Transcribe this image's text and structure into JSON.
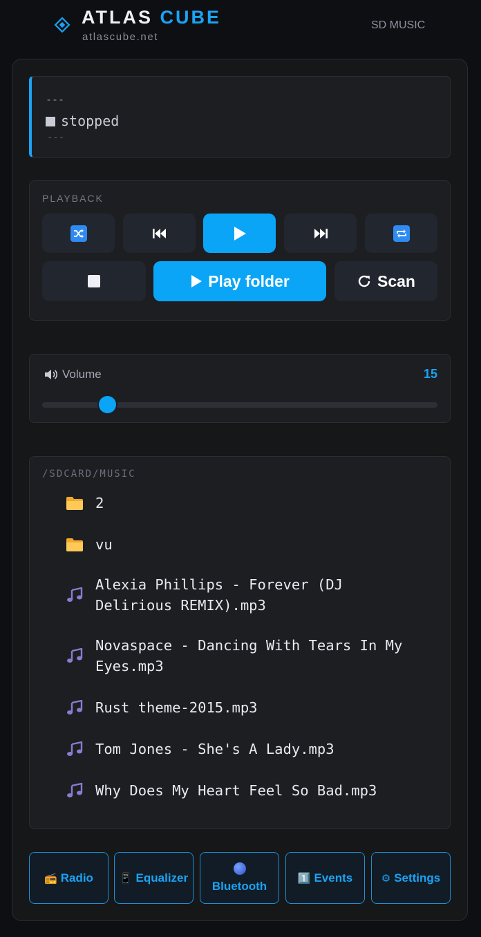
{
  "header": {
    "brand_word1": "ATLAS",
    "brand_word2": "CUBE",
    "domain": "atlascube.net",
    "section": "SD MUSIC"
  },
  "status": {
    "line1": "---",
    "state": "stopped",
    "line3": "---"
  },
  "playback": {
    "title": "PLAYBACK",
    "shuffle_icon": "shuffle-icon",
    "prev_icon": "skip-previous-icon",
    "play_icon": "play-icon",
    "next_icon": "skip-next-icon",
    "repeat_icon": "repeat-icon",
    "stop_icon": "stop-icon",
    "play_folder_label": "Play folder",
    "scan_label": "Scan"
  },
  "volume": {
    "label": "Volume",
    "value": "15",
    "level_fraction": 0.165
  },
  "files": {
    "path": "/SDCARD/MUSIC",
    "items": [
      {
        "type": "folder",
        "name": "2"
      },
      {
        "type": "folder",
        "name": "vu"
      },
      {
        "type": "file",
        "name": "Alexia Phillips - Forever (DJ Delirious REMIX).mp3"
      },
      {
        "type": "file",
        "name": "Novaspace - Dancing With Tears In My Eyes.mp3"
      },
      {
        "type": "file",
        "name": "Rust theme-2015.mp3"
      },
      {
        "type": "file",
        "name": "Tom Jones - She's A Lady.mp3"
      },
      {
        "type": "file",
        "name": "Why Does My Heart Feel So Bad.mp3"
      }
    ]
  },
  "nav": {
    "radio": {
      "icon": "📻",
      "label": "Radio"
    },
    "equalizer": {
      "icon": "📱",
      "label": "Equalizer"
    },
    "bluetooth": {
      "label": "Bluetooth"
    },
    "events": {
      "icon": "1️⃣",
      "label": "Events"
    },
    "settings": {
      "icon": "⚙",
      "label": "Settings"
    }
  },
  "colors": {
    "accent": "#0aa5f7",
    "background": "#0e0f12",
    "panel": "#1d1e22",
    "folder": "#f5b73a",
    "music_note": "#8b7bd1"
  }
}
